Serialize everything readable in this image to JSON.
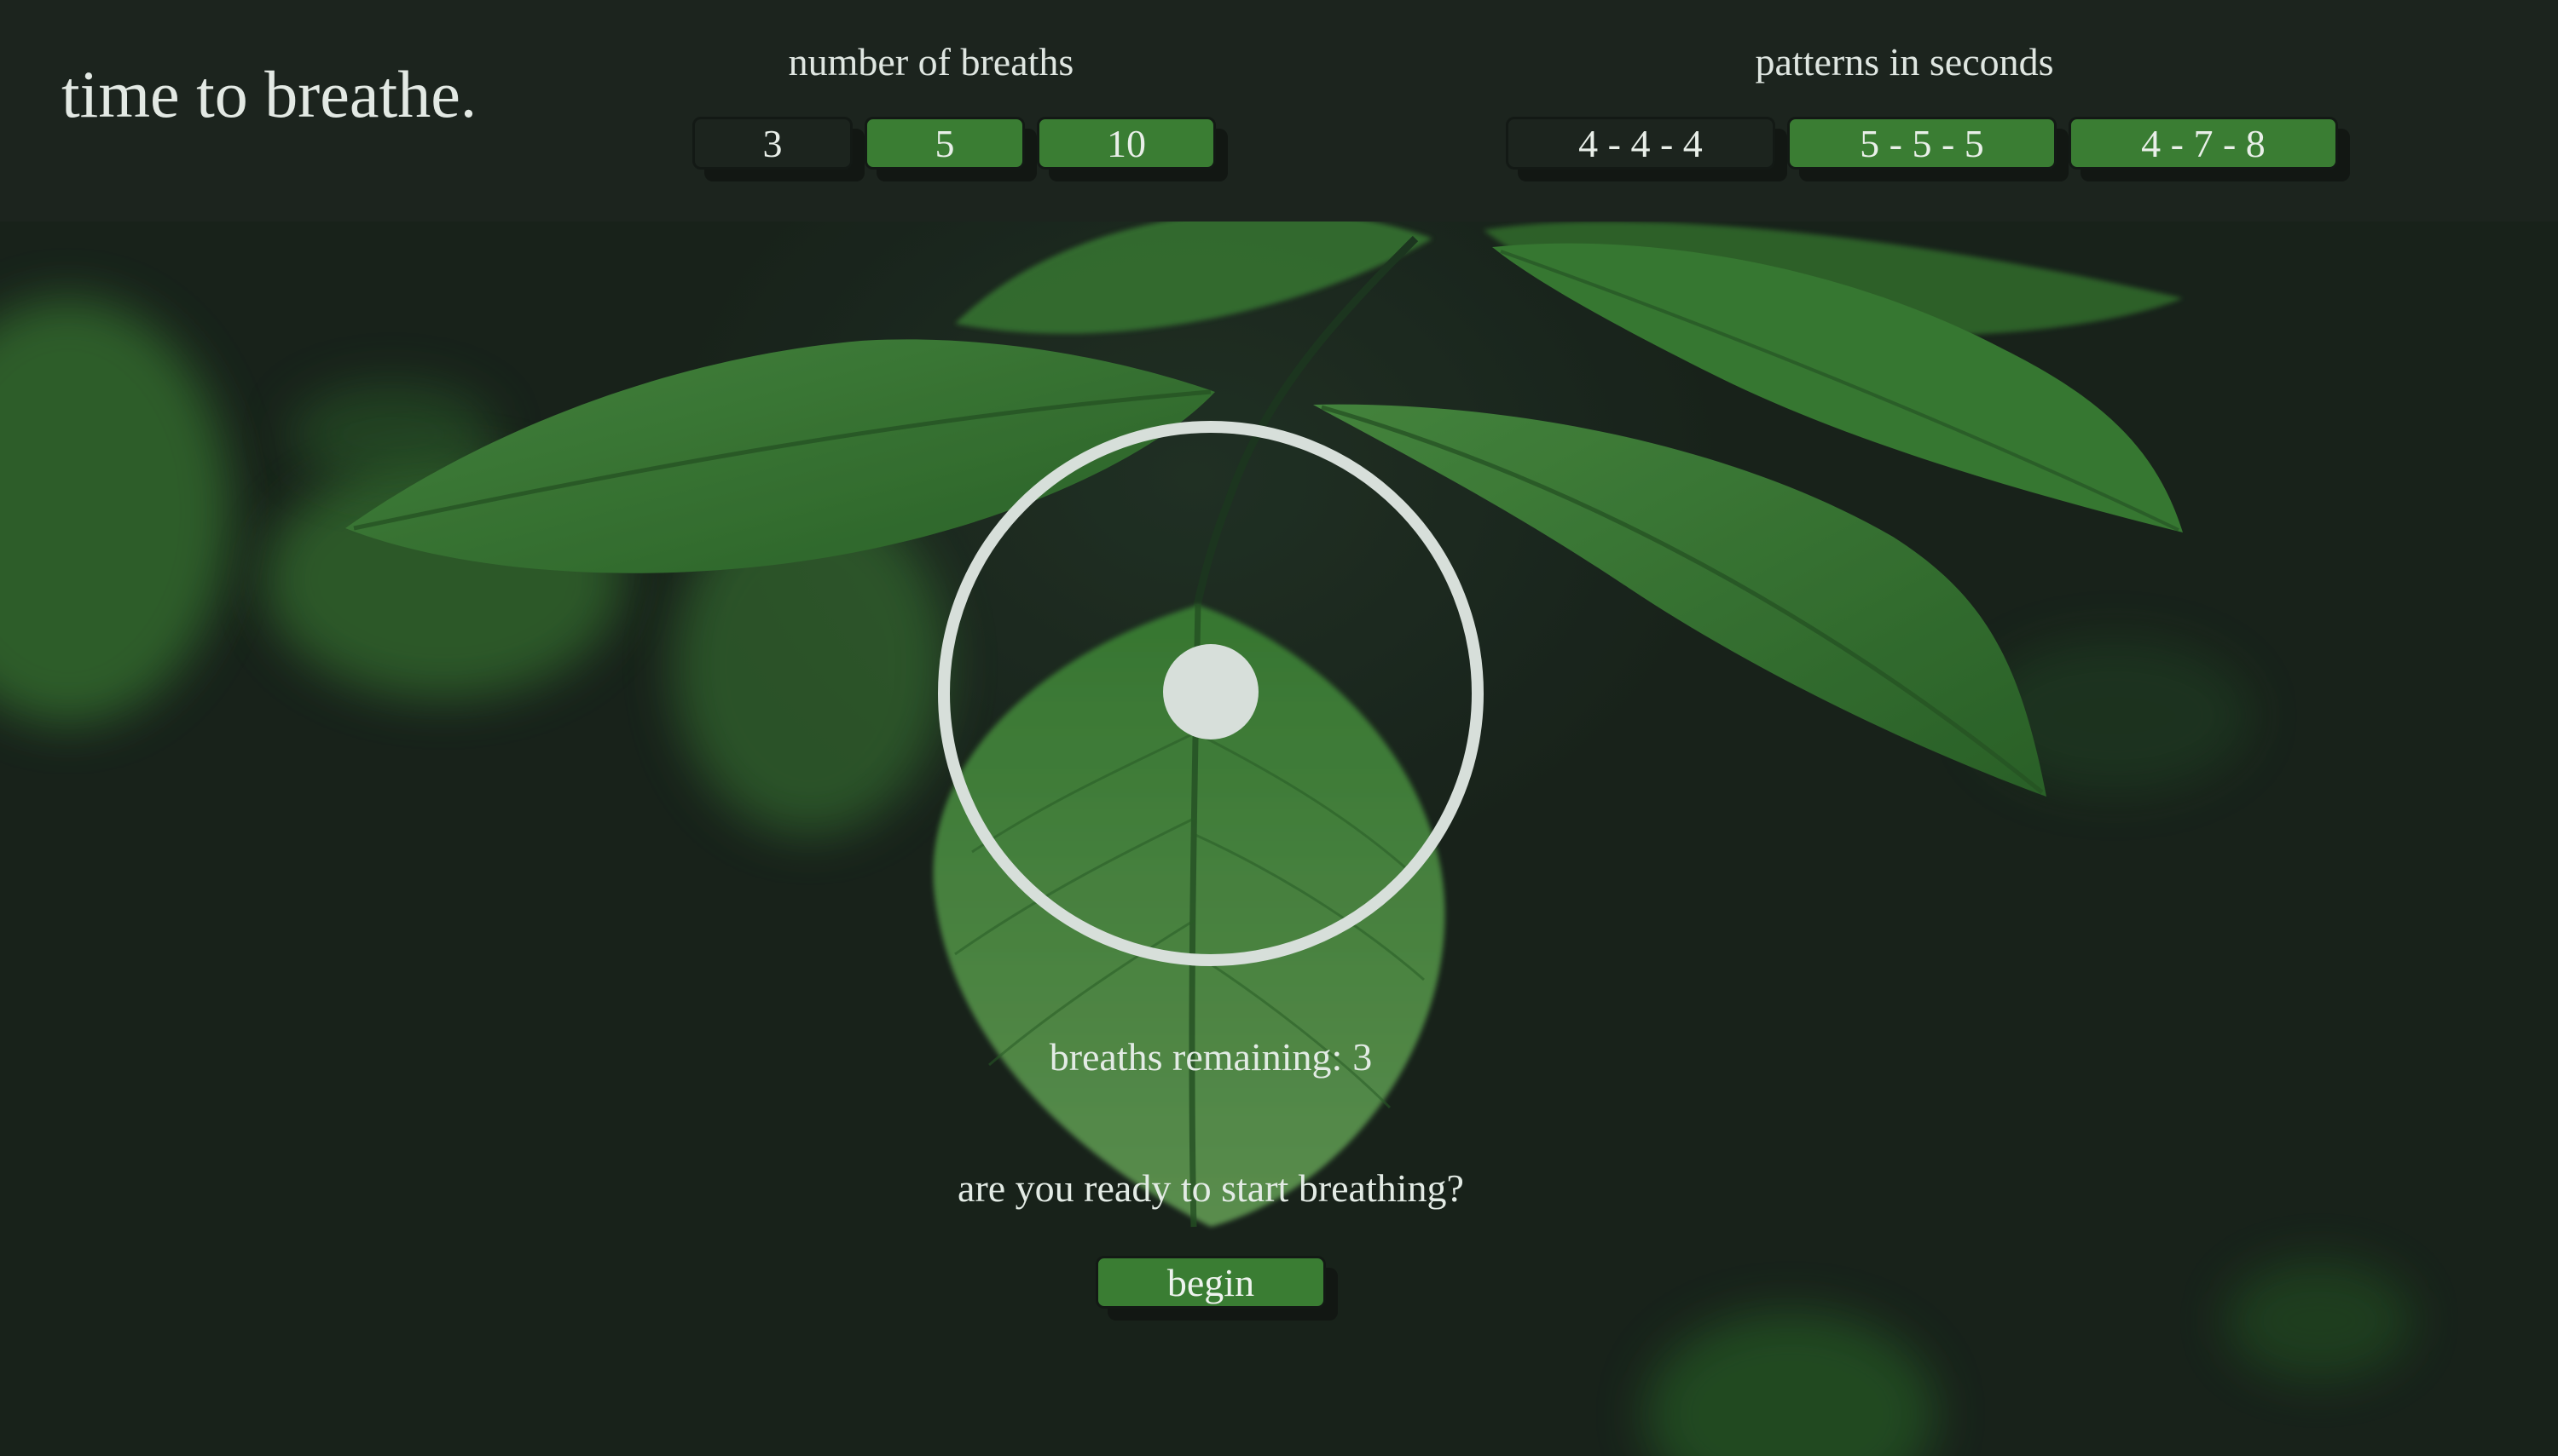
{
  "app": {
    "title": "time to breathe."
  },
  "breaths": {
    "label": "number of breaths",
    "options": [
      "3",
      "5",
      "10"
    ],
    "selected": "3"
  },
  "patterns": {
    "label": "patterns in seconds",
    "options": [
      "4 - 4 - 4",
      "5 - 5 - 5",
      "4 - 7 - 8"
    ],
    "selected": "4 - 4 - 4"
  },
  "status": {
    "remaining_label": "breaths remaining:",
    "remaining_count": "3",
    "prompt": "are you ready to start breathing?"
  },
  "actions": {
    "begin_label": "begin"
  },
  "colors": {
    "background": "#1c241e",
    "button_active": "#3a7d33",
    "button_inactive": "#1c241e",
    "text": "#dfe6e1",
    "circle": "#d7dfda"
  },
  "icons": {
    "breath_ring": "ring-circle-icon",
    "breath_dot": "dot-circle-icon"
  }
}
